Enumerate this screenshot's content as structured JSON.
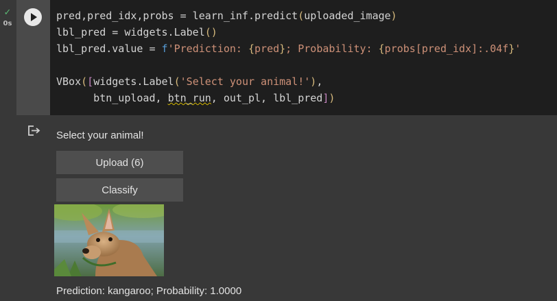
{
  "cell": {
    "status_check": "✓",
    "exec_time": "0s",
    "code_lines": [
      "pred,pred_idx,probs = learn_inf.predict(uploaded_image)",
      "lbl_pred = widgets.Label()",
      "lbl_pred.value = f'Prediction: {pred}; Probability: {probs[pred_idx]:.04f}'",
      "",
      "VBox([widgets.Label('Select your animal!'),",
      "      btn_upload, btn_run, out_pl, lbl_pred])"
    ]
  },
  "output": {
    "label": "Select your animal!",
    "upload_button": "Upload (6)",
    "classify_button": "Classify",
    "image_subject": "kangaroo",
    "prediction": "Prediction: kangaroo; Probability: 1.0000"
  },
  "icons": [
    "check-icon",
    "run-icon",
    "output-icon"
  ],
  "colors": {
    "editor_bg": "#1e1e1e",
    "panel_bg": "#383838",
    "button_bg": "#4e4e4e",
    "success": "#5bb974",
    "string": "#ce9178",
    "keyword": "#569cd6",
    "bracket": "#d7ba7d"
  }
}
